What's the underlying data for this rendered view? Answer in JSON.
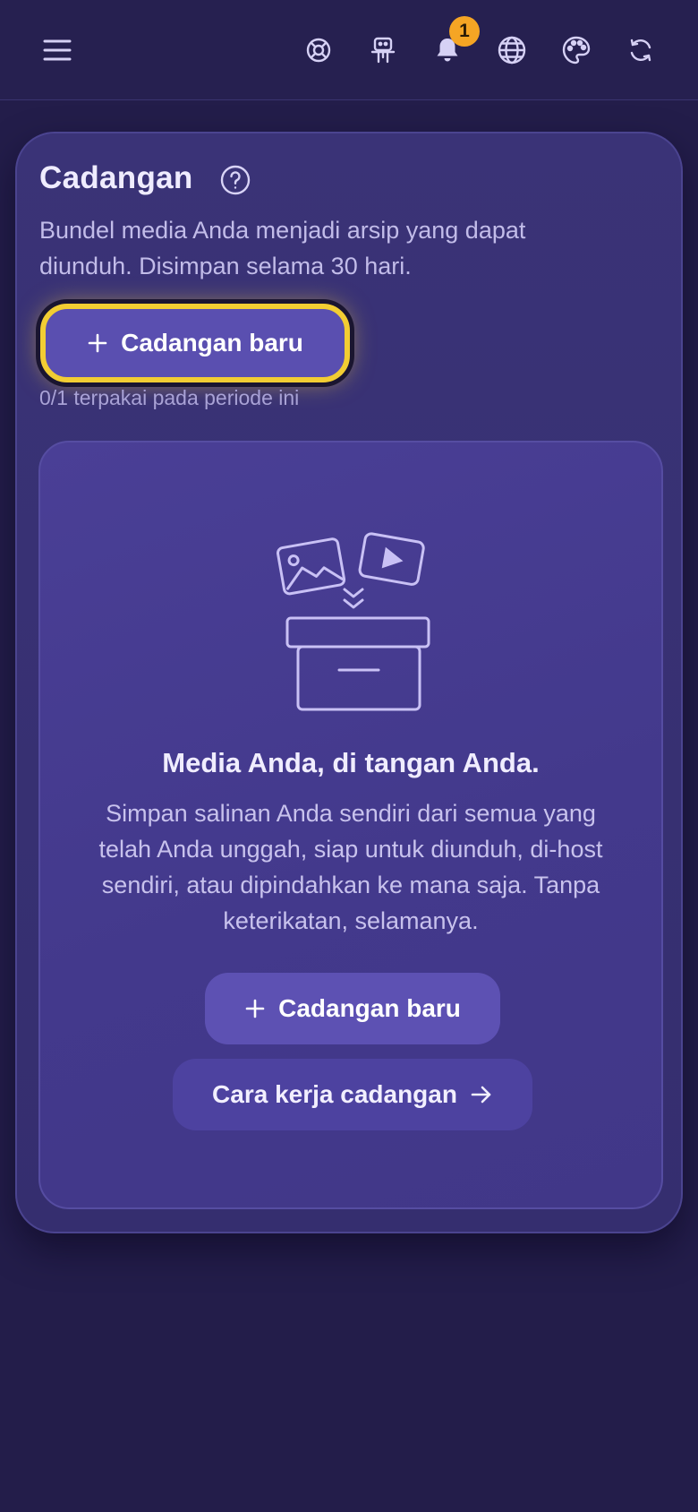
{
  "topbar": {
    "icons": [
      "menu-icon",
      "help-lifebuoy-icon",
      "robot-icon",
      "bell-icon",
      "globe-icon",
      "palette-icon",
      "refresh-icon"
    ],
    "notification_count": "1"
  },
  "backup": {
    "title": "Cadangan",
    "description": "Bundel media Anda menjadi arsip yang dapat diunduh. Disimpan selama 30 hari.",
    "new_backup_label": "Cadangan baru",
    "usage_text": "0/1 terpakai pada periode ini"
  },
  "empty_state": {
    "title": "Media Anda, di tangan Anda.",
    "description": "Simpan salinan Anda sendiri dari semua yang telah Anda unggah, siap untuk diunduh, di-host sendiri, atau dipindahkan ke mana saja. Tanpa keterikatan, selamanya.",
    "new_backup_label": "Cadangan baru",
    "how_it_works_label": "Cara kerja cadangan"
  },
  "colors": {
    "background": "#231d4a",
    "card": "#3a3377",
    "accent": "#5a4fb0",
    "focus_ring": "#f2cd33",
    "badge": "#f5a524"
  }
}
